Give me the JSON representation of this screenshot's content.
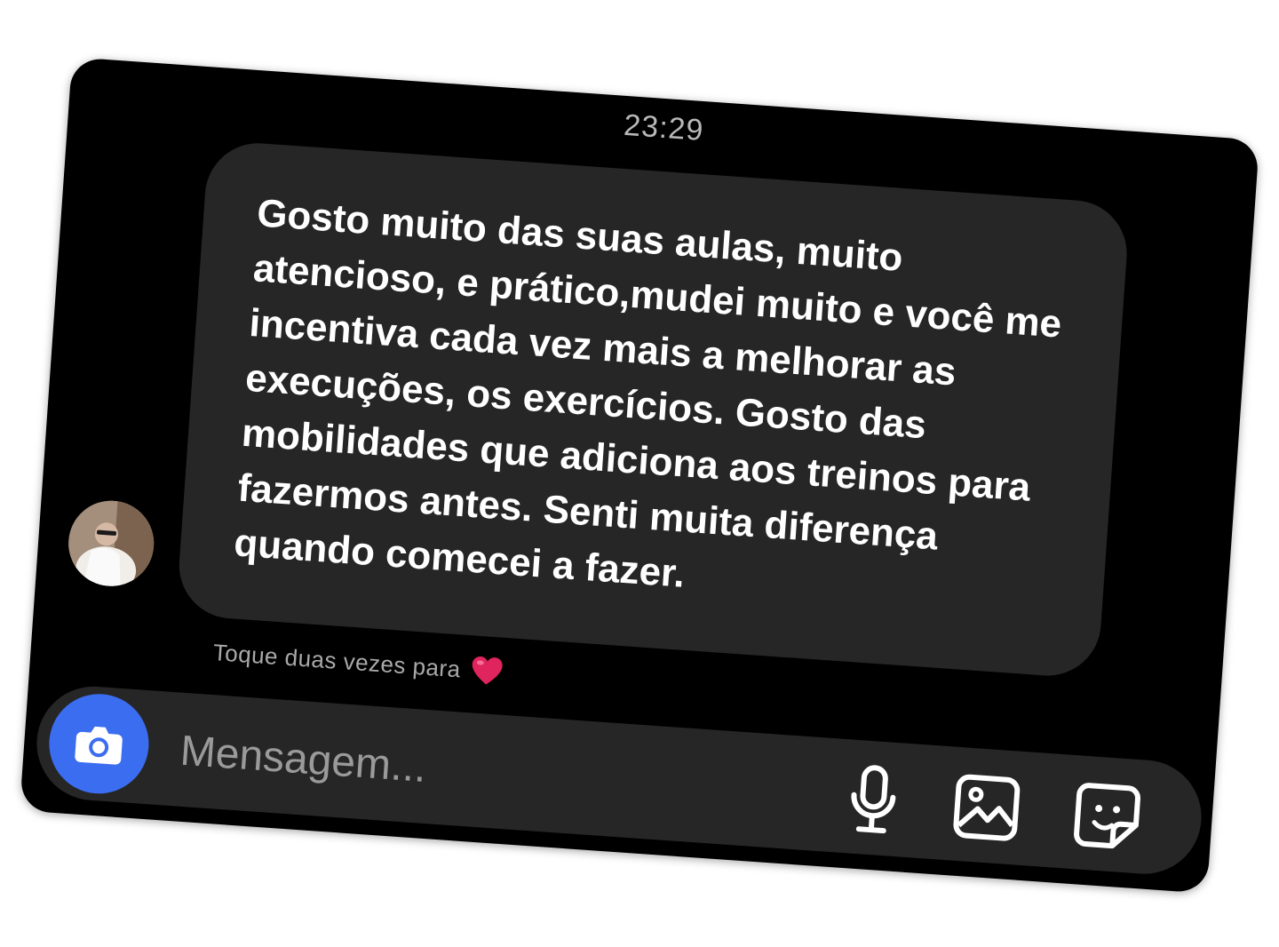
{
  "thread": {
    "timestamp": "23:29",
    "message": {
      "text": "Gosto muito das suas aulas, muito atencioso, e prático,mudei muito e você me incentiva cada vez mais a melhorar as execuções, os exercícios. Gosto das mobilidades que adiciona aos treinos para fazermos antes. Senti muita diferença quando comecei a fazer.",
      "sender_avatar_icon": "avatar-photo"
    },
    "hint": {
      "text": "Toque duas vezes para",
      "icon": "heart-icon",
      "icon_color": "#e0245e"
    }
  },
  "composer": {
    "placeholder": "Mensagem...",
    "camera_icon": "camera-icon",
    "camera_color": "#3b6df0",
    "actions": [
      "microphone-icon",
      "gallery-icon",
      "sticker-icon"
    ]
  }
}
